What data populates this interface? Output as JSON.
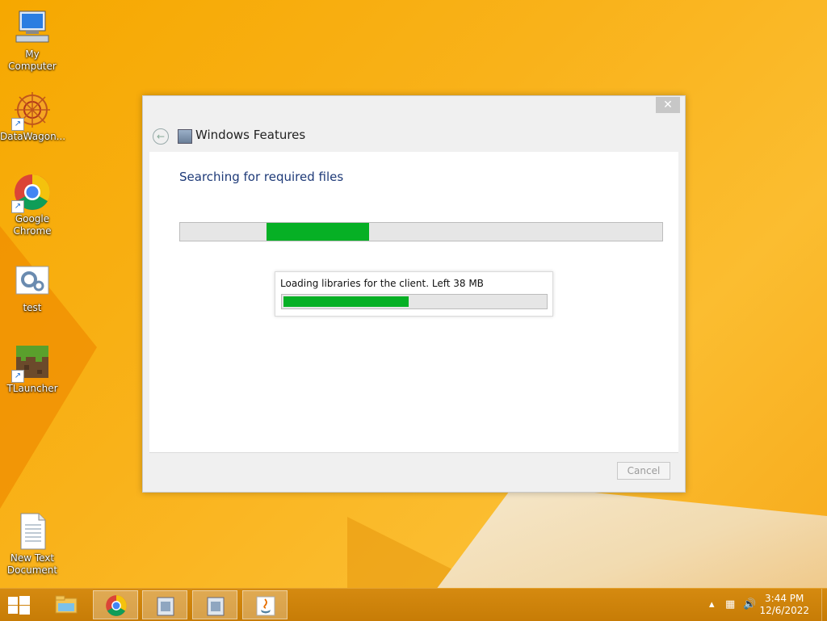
{
  "desktop": {
    "icons": [
      {
        "label": "My Computer",
        "icon": "computer-icon"
      },
      {
        "label": "DataWagon...",
        "icon": "datawagon-icon"
      },
      {
        "label": "Google Chrome",
        "icon": "chrome-icon"
      },
      {
        "label": "test",
        "icon": "settings-file-icon"
      },
      {
        "label": "TLauncher",
        "icon": "minecraft-block-icon"
      },
      {
        "label": "New Text Document",
        "icon": "text-document-icon"
      }
    ]
  },
  "dialog": {
    "title": "Windows Features",
    "close_label": "✕",
    "back_label": "←",
    "heading": "Searching for required files",
    "main_progress": {
      "start": 0.18,
      "end": 0.392
    },
    "sub_status": "Loading libraries for the client. Left 38 MB",
    "sub_progress": 0.48,
    "cancel_label": "Cancel"
  },
  "taskbar": {
    "items": [
      {
        "name": "start",
        "icon": "windows-logo-icon"
      },
      {
        "name": "file-explorer",
        "icon": "folder-icon"
      },
      {
        "name": "chrome",
        "icon": "chrome-icon",
        "active": true
      },
      {
        "name": "windows-features",
        "icon": "installer-icon"
      },
      {
        "name": "windows-features-2",
        "icon": "installer-icon"
      },
      {
        "name": "java",
        "icon": "java-icon"
      }
    ],
    "time": "3:44 PM",
    "date": "12/6/2022"
  },
  "colors": {
    "accent_green": "#06b025",
    "heading_blue": "#1e3a78",
    "desktop_orange": "#f9b21a"
  }
}
